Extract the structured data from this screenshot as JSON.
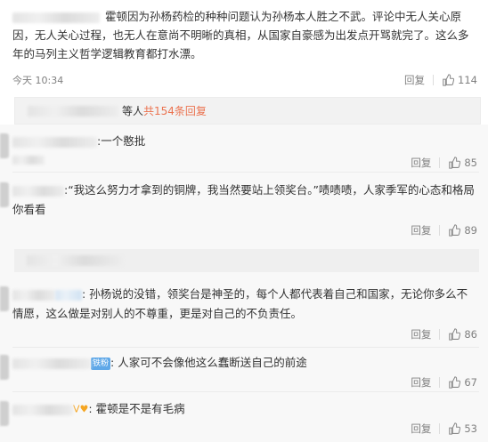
{
  "top_comment": {
    "text": "霍顿因为孙杨药检的种种问题认为孙杨本人胜之不武。评论中无人关心原因，无人关心过程，也无人在意尚不明晰的真相，从国家自豪感为出发点开骂就完了。这么多年的马列主义哲学逻辑教育都打水漂。",
    "time": "今天 10:34",
    "reply_label": "回复",
    "like_count": "114"
  },
  "replies_bar": {
    "suffix": "等人",
    "link": "共154条回复"
  },
  "replies": [
    {
      "text": ":一个憨批",
      "reply_label": "回复",
      "like_count": "85"
    },
    {
      "text": ":“我这么努力才拿到的铜牌，我当然要站上领奖台。”啧啧啧，人家季军的心态和格局你看看",
      "reply_label": "回复",
      "like_count": "89"
    },
    {
      "text": ": 孙杨说的没错，领奖台是神圣的，每个人都代表着自己和国家，无论你多么不情愿，这么做是对别人的不尊重，更是对自己的不负责任。",
      "reply_label": "回复",
      "like_count": "86"
    },
    {
      "text": ": 人家可不会像他这么蠢断送自己的前途",
      "badge": "铁粉",
      "reply_label": "回复",
      "like_count": "67"
    },
    {
      "text": ": 霍顿是不是有毛病",
      "reply_label": "回复",
      "like_count": "53"
    }
  ],
  "colors": {
    "link": "#eb7350",
    "muted": "#808080",
    "badge": "#5fa8e8"
  },
  "icons": {
    "like": "thumbs-up-icon"
  }
}
